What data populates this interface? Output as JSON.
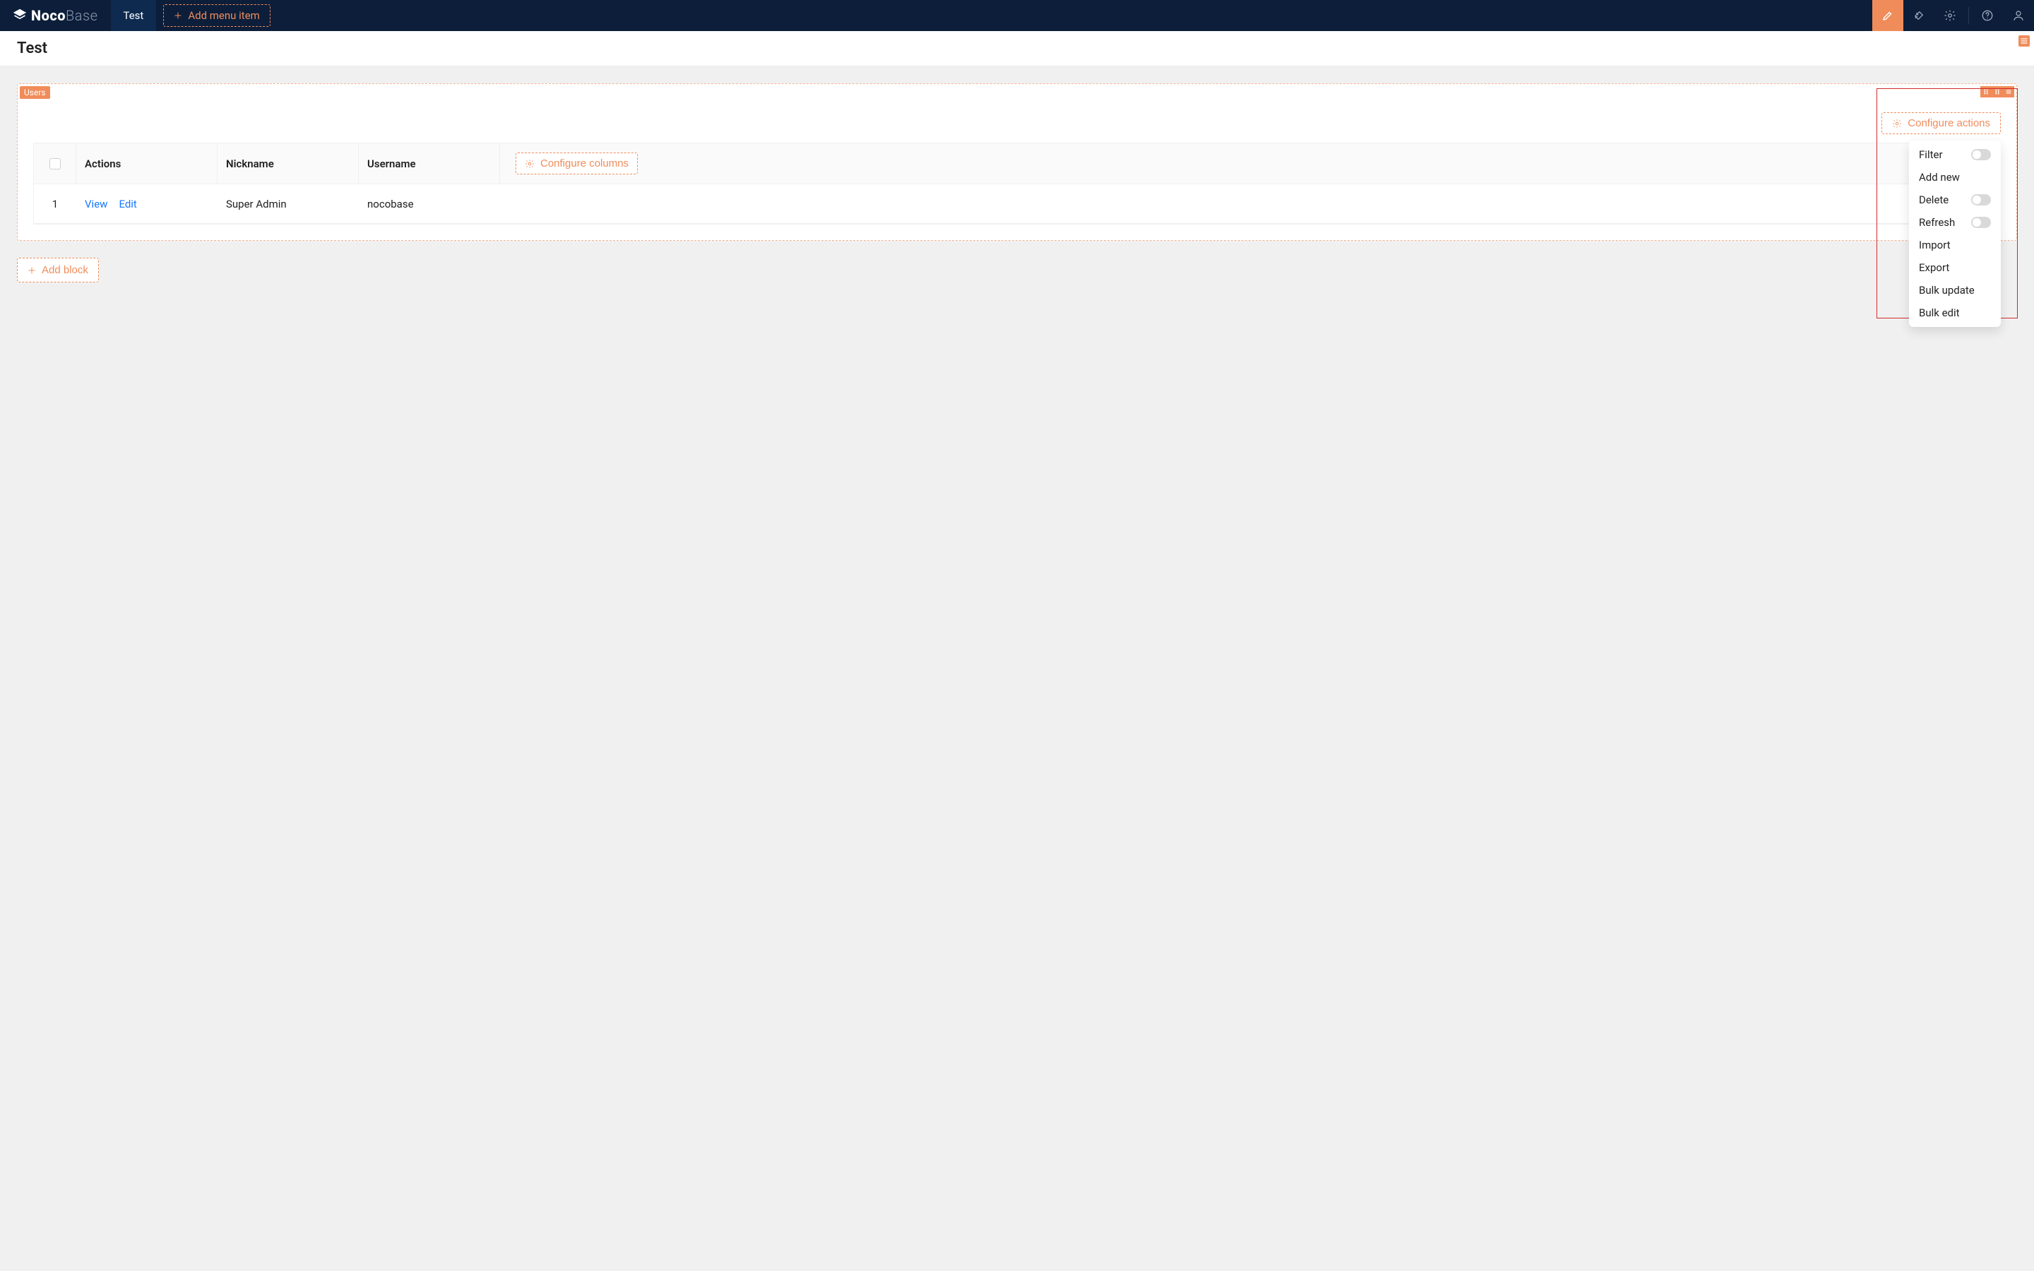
{
  "topbar": {
    "brand_bold": "Noco",
    "brand_light": "Base",
    "tab_label": "Test",
    "add_menu_label": "Add menu item"
  },
  "page": {
    "title": "Test"
  },
  "block": {
    "tag": "Users",
    "configure_actions_label": "Configure actions",
    "configure_columns_label": "Configure columns",
    "columns": {
      "actions": "Actions",
      "nickname": "Nickname",
      "username": "Username"
    },
    "row": {
      "index": "1",
      "view": "View",
      "edit": "Edit",
      "nickname": "Super Admin",
      "username": "nocobase"
    }
  },
  "dropdown": {
    "items": [
      {
        "label": "Filter",
        "toggle": true
      },
      {
        "label": "Add new",
        "toggle": false
      },
      {
        "label": "Delete",
        "toggle": true
      },
      {
        "label": "Refresh",
        "toggle": true
      },
      {
        "label": "Import",
        "toggle": false
      },
      {
        "label": "Export",
        "toggle": false
      },
      {
        "label": "Bulk update",
        "toggle": false
      },
      {
        "label": "Bulk edit",
        "toggle": false
      }
    ]
  },
  "add_block_label": "Add block"
}
